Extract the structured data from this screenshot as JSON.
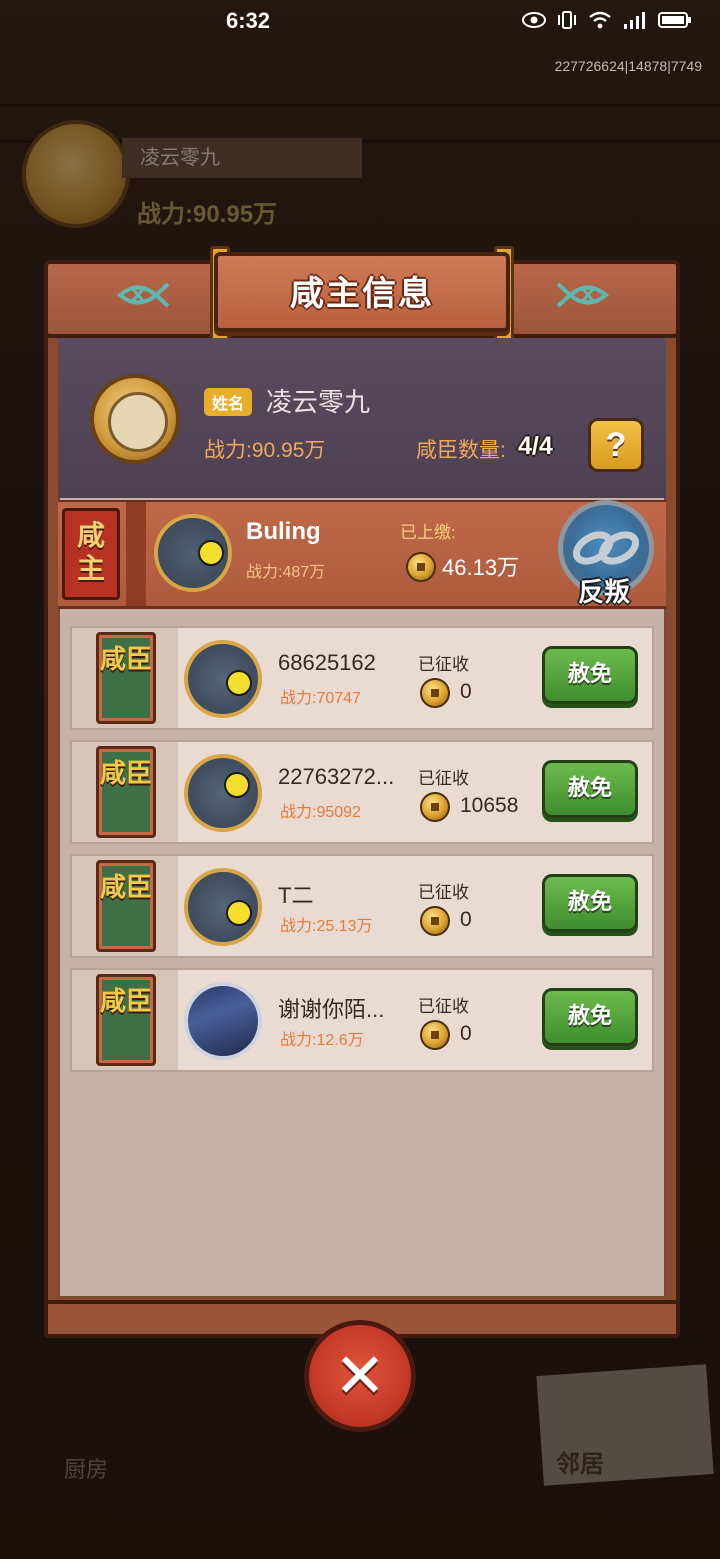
{
  "status_bar": {
    "time": "6:32",
    "server_id": "227726624|14878|7749"
  },
  "background": {
    "profile_name": "凌云零九",
    "profile_power": "战力:90.95万",
    "kitchen_label": "厨房",
    "neighbor_label": "邻居"
  },
  "modal": {
    "title": "咸主信息",
    "lord": {
      "name_tag": "姓名",
      "name": "凌云零九",
      "power": "战力:90.95万",
      "vassal_count_label": "咸臣数量:",
      "vassal_count": "4/4",
      "help_label": "?"
    },
    "master": {
      "badge": "咸主",
      "name": "Buling",
      "power": "战力:487万",
      "paid_label": "已上缴:",
      "paid_value": "46.13万",
      "rebel_label": "反叛"
    },
    "vassals": [
      {
        "badge": "咸臣",
        "name": "68625162",
        "power": "战力:70747",
        "collected_label": "已征收",
        "collected": "0",
        "pardon_label": "赦免"
      },
      {
        "badge": "咸臣",
        "name": "22763272...",
        "power": "战力:95092",
        "collected_label": "已征收",
        "collected": "10658",
        "pardon_label": "赦免"
      },
      {
        "badge": "咸臣",
        "name": "T二",
        "power": "战力:25.13万",
        "collected_label": "已征收",
        "collected": "0",
        "pardon_label": "赦免"
      },
      {
        "badge": "咸臣",
        "name": "谢谢你陌...",
        "power": "战力:12.6万",
        "collected_label": "已征收",
        "collected": "0",
        "pardon_label": "赦免"
      }
    ],
    "close_label": "✕"
  },
  "colors": {
    "accent_orange": "#f0a85a",
    "pardon_green": "#3f8d2e",
    "close_red": "#c63a27",
    "title_board": "#b9603f"
  }
}
